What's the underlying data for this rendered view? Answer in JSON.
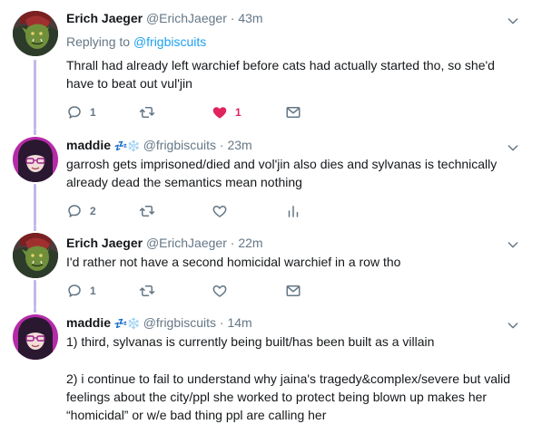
{
  "tweets": [
    {
      "name": "Erich Jaeger",
      "handle": "@ErichJaeger",
      "sep": "·",
      "time": "43m",
      "reply_prefix": "Replying to",
      "reply_to": "@frigbiscuits",
      "text": "Thrall had already left warchief before cats had actually started tho, so she'd have to beat out vul'jin",
      "reply_count": "1",
      "like_count": "1",
      "liked": true
    },
    {
      "name": "maddie",
      "emoji": "💤❄️",
      "handle": "@frigbiscuits",
      "sep": "·",
      "time": "23m",
      "text": "garrosh gets imprisoned/died and vol'jin also dies and sylvanas is technically already dead the semantics mean nothing",
      "reply_count": "2"
    },
    {
      "name": "Erich Jaeger",
      "handle": "@ErichJaeger",
      "sep": "·",
      "time": "22m",
      "text": "I'd rather not have a second homicidal warchief in a row tho",
      "reply_count": "1"
    },
    {
      "name": "maddie",
      "emoji": "💤❄️",
      "handle": "@frigbiscuits",
      "sep": "·",
      "time": "14m",
      "text_p1": "1) third, sylvanas is currently being built/has been built as a villain",
      "text_p2": "2) i continue to fail to understand why jaina's tragedy&complex/severe but valid feelings about the city/ppl she worked to protect being blown up makes her “homicidal” or w/e bad thing ppl are calling her"
    }
  ],
  "colors": {
    "thread_line": "#c5b8e8",
    "link": "#1da1f2",
    "muted": "#657786",
    "like": "#e0245e"
  }
}
